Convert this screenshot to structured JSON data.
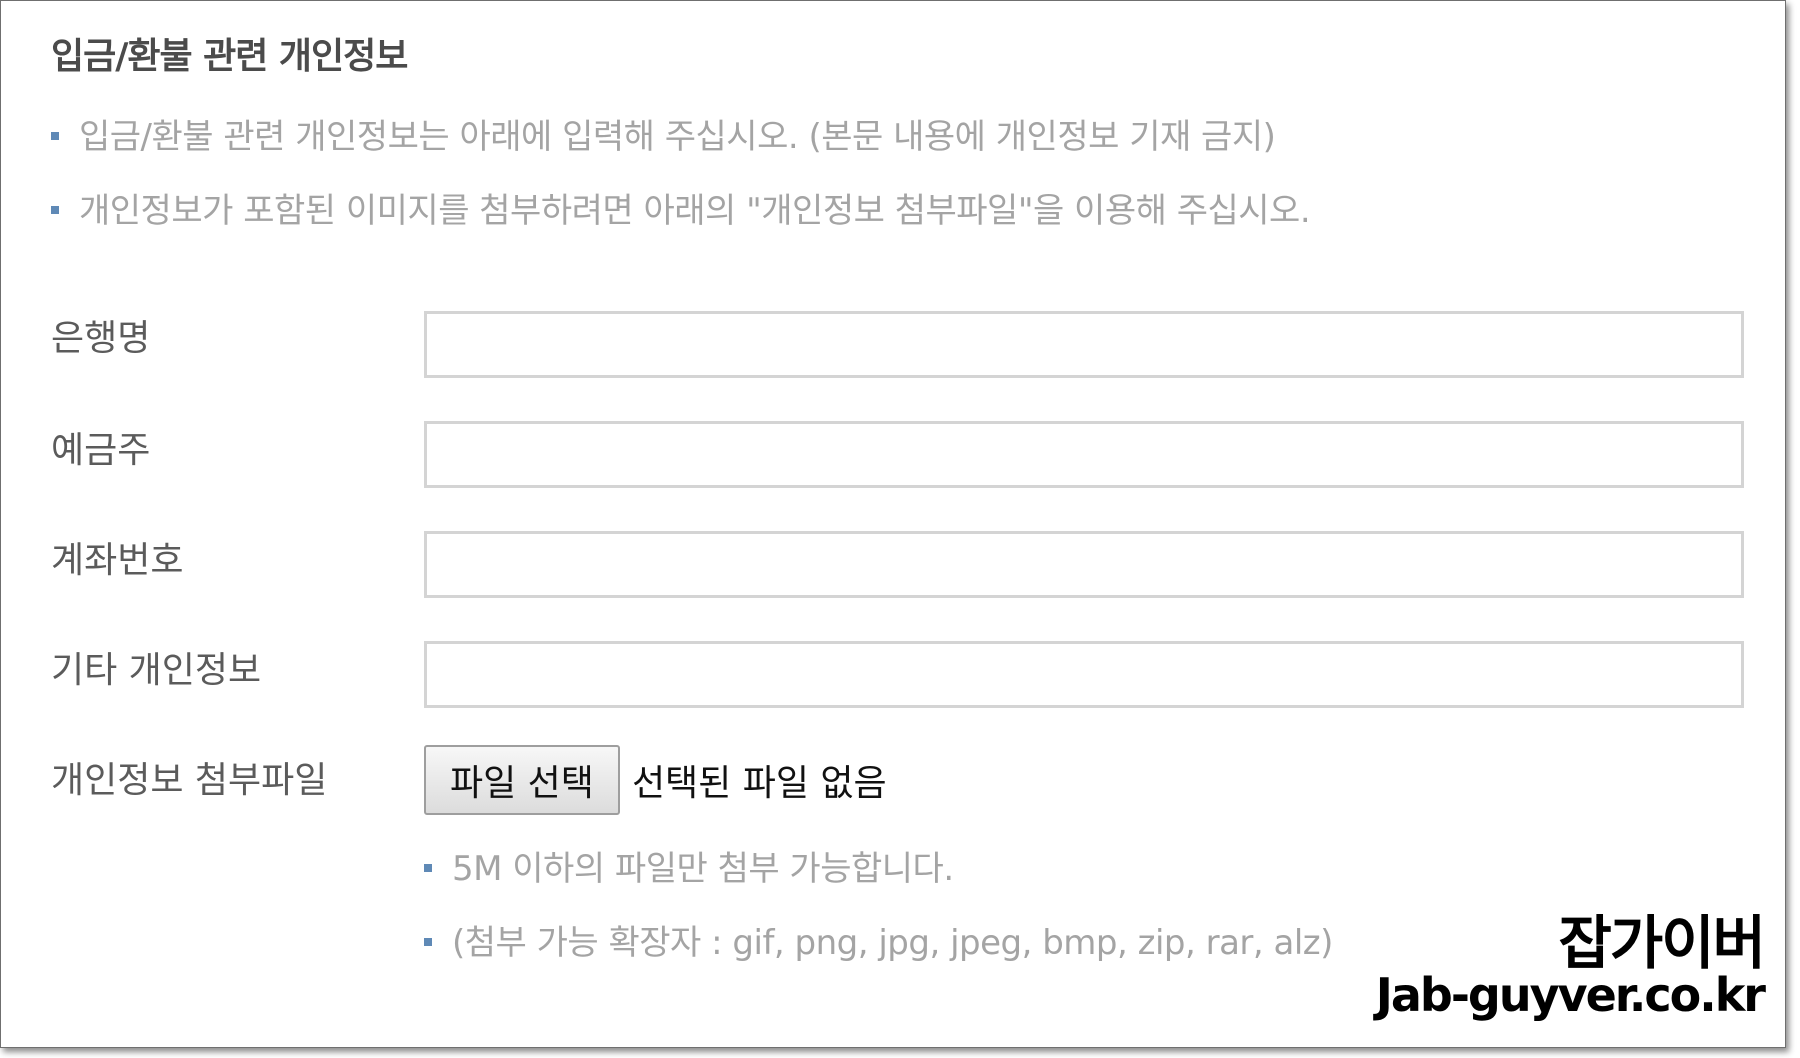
{
  "section": {
    "title": "입금/환불 관련 개인정보",
    "notices": [
      "입금/환불 관련 개인정보는 아래에 입력해 주십시오. (본문 내용에 개인정보 기재 금지)",
      "개인정보가 포함된 이미지를 첨부하려면 아래의 \"개인정보 첨부파일\"을 이용해 주십시오."
    ]
  },
  "form": {
    "bank_name": {
      "label": "은행명",
      "value": ""
    },
    "account_holder": {
      "label": "예금주",
      "value": ""
    },
    "account_number": {
      "label": "계좌번호",
      "value": ""
    },
    "other_info": {
      "label": "기타 개인정보",
      "value": ""
    },
    "attachment": {
      "label": "개인정보 첨부파일",
      "button_label": "파일 선택",
      "status": "선택된 파일 없음",
      "hints": [
        "5M 이하의 파일만 첨부 가능합니다.",
        "(첨부 가능 확장자 : gif, png, jpg, jpeg, bmp, zip, rar, alz)"
      ]
    }
  },
  "watermark": {
    "name": "잡가이버",
    "url": "Jab-guyver.co.kr"
  },
  "colors": {
    "bullet": "#5f89b6",
    "notice_text": "#a4a4a4",
    "label_text": "#5b5b5b",
    "field_border": "#d4d4d4"
  }
}
